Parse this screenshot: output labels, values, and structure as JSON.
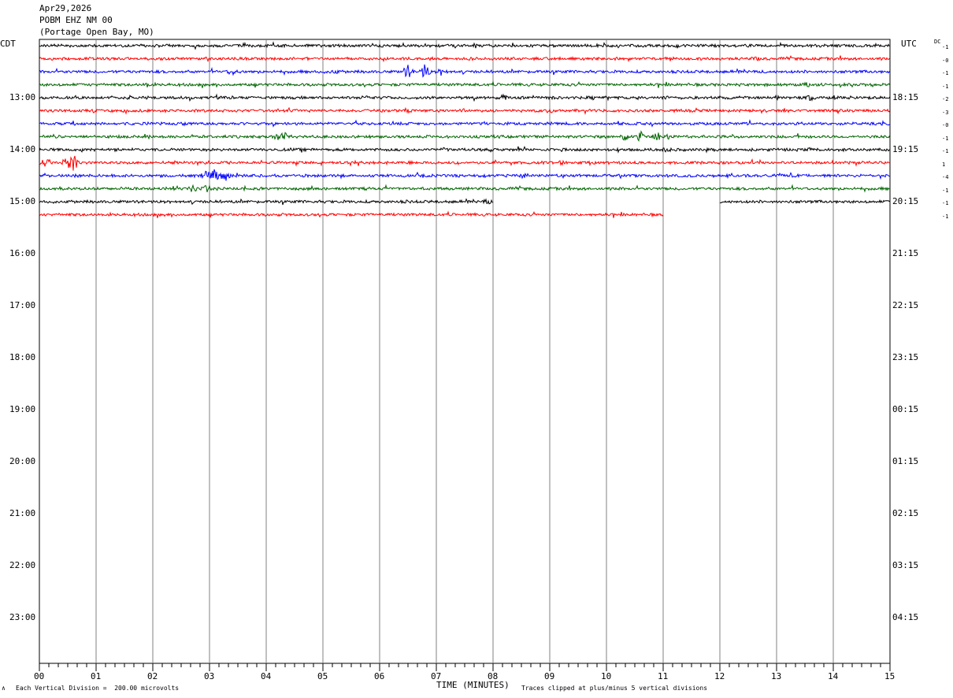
{
  "header": {
    "date": "Apr29,2026",
    "station": "POBM EHZ NM 00",
    "location": "(Portage Open Bay, MO)"
  },
  "left_zone": "CDT",
  "right_zone": "UTC",
  "dc_header": "DC",
  "dc_values": [
    "-1",
    "-0",
    "-1",
    "-1",
    "-2",
    "-3",
    "-0",
    "-1",
    "-1",
    "1",
    "-4",
    "-1",
    "-1",
    "-1"
  ],
  "footer": {
    "logo": "∧",
    "scale": "Each Vertical Division =  200.00 microvolts",
    "xlabel": "TIME (MINUTES)",
    "clip": "Traces clipped at plus/minus 5 vertical divisions"
  },
  "colors": {
    "black": "#000000",
    "red": "#ff0000",
    "blue": "#0000ff",
    "green": "#006400",
    "grid": "#808080"
  },
  "chart_data": {
    "type": "line",
    "title": "POBM EHZ NM 00",
    "xlabel": "TIME (MINUTES)",
    "xlim": [
      0,
      15
    ],
    "x_ticks": [
      "00",
      "01",
      "02",
      "03",
      "04",
      "05",
      "06",
      "07",
      "08",
      "09",
      "10",
      "11",
      "12",
      "13",
      "14",
      "15"
    ],
    "left_time_labels": [
      "13:00",
      "14:00",
      "15:00",
      "16:00",
      "17:00",
      "18:00",
      "19:00",
      "20:00",
      "21:00",
      "22:00",
      "23:00"
    ],
    "right_time_labels": [
      "18:15",
      "19:15",
      "20:15",
      "21:15",
      "22:15",
      "23:15",
      "00:15",
      "01:15",
      "02:15",
      "03:15",
      "04:15"
    ],
    "trace_colors": [
      "black",
      "red",
      "blue",
      "green"
    ],
    "trace_minutes_each": 15,
    "traces": [
      {
        "row": 0,
        "color": "black",
        "start": 0,
        "end": 15,
        "bursts": []
      },
      {
        "row": 1,
        "color": "red",
        "start": 0,
        "end": 15,
        "bursts": [
          [
            12.65,
            2
          ]
        ]
      },
      {
        "row": 2,
        "color": "blue",
        "start": 0,
        "end": 15,
        "bursts": [
          [
            3.4,
            4
          ],
          [
            5.2,
            2.5
          ],
          [
            6.5,
            8
          ],
          [
            6.8,
            10
          ],
          [
            7.1,
            5
          ]
        ]
      },
      {
        "row": 3,
        "color": "green",
        "start": 0,
        "end": 15,
        "bursts": [
          [
            1.9,
            2.5
          ],
          [
            13.55,
            2.5
          ]
        ]
      },
      {
        "row": 4,
        "color": "black",
        "start": 0,
        "end": 15,
        "bursts": [
          [
            1.6,
            2
          ],
          [
            5.75,
            3
          ],
          [
            8.2,
            4
          ],
          [
            9.0,
            2
          ],
          [
            11.05,
            2
          ],
          [
            12.0,
            2
          ],
          [
            13.0,
            2
          ],
          [
            13.6,
            3.5
          ]
        ]
      },
      {
        "row": 5,
        "color": "red",
        "start": 0,
        "end": 15,
        "bursts": [
          [
            6.5,
            2
          ],
          [
            7.5,
            2.5
          ],
          [
            9.0,
            2.5
          ]
        ]
      },
      {
        "row": 6,
        "color": "blue",
        "start": 0,
        "end": 15,
        "bursts": [
          [
            2.5,
            2
          ]
        ]
      },
      {
        "row": 7,
        "color": "green",
        "start": 0,
        "end": 15,
        "bursts": [
          [
            4.2,
            4
          ],
          [
            4.35,
            5
          ],
          [
            10.3,
            6
          ],
          [
            10.6,
            7
          ],
          [
            10.9,
            6
          ],
          [
            11.1,
            4
          ]
        ]
      },
      {
        "row": 8,
        "color": "black",
        "start": 0,
        "end": 15,
        "bursts": [
          [
            7.15,
            2
          ],
          [
            11.05,
            3.5
          ],
          [
            13.6,
            2
          ]
        ]
      },
      {
        "row": 9,
        "color": "red",
        "start": 0,
        "end": 15,
        "bursts": [
          [
            0.1,
            4
          ],
          [
            0.5,
            9
          ],
          [
            0.6,
            10
          ],
          [
            6.5,
            2
          ],
          [
            9.2,
            2.5
          ]
        ]
      },
      {
        "row": 10,
        "color": "blue",
        "start": 0,
        "end": 15,
        "bursts": [
          [
            0.7,
            3
          ],
          [
            2.95,
            7
          ],
          [
            3.1,
            9
          ],
          [
            3.3,
            6
          ],
          [
            8.55,
            3
          ],
          [
            13.0,
            2
          ]
        ]
      },
      {
        "row": 11,
        "color": "green",
        "start": 0,
        "end": 15,
        "bursts": [
          [
            1.65,
            2
          ],
          [
            2.4,
            3.5
          ],
          [
            2.7,
            4
          ],
          [
            2.95,
            5
          ]
        ]
      },
      {
        "row": 12,
        "color": "black",
        "start": 0,
        "end": 8.0,
        "bursts": [
          [
            6.5,
            1.5
          ],
          [
            7.9,
            2.5
          ]
        ],
        "extra": [
          12.0,
          15
        ]
      },
      {
        "row": 13,
        "color": "red",
        "start": 0,
        "end": 11.0,
        "bursts": []
      }
    ]
  }
}
